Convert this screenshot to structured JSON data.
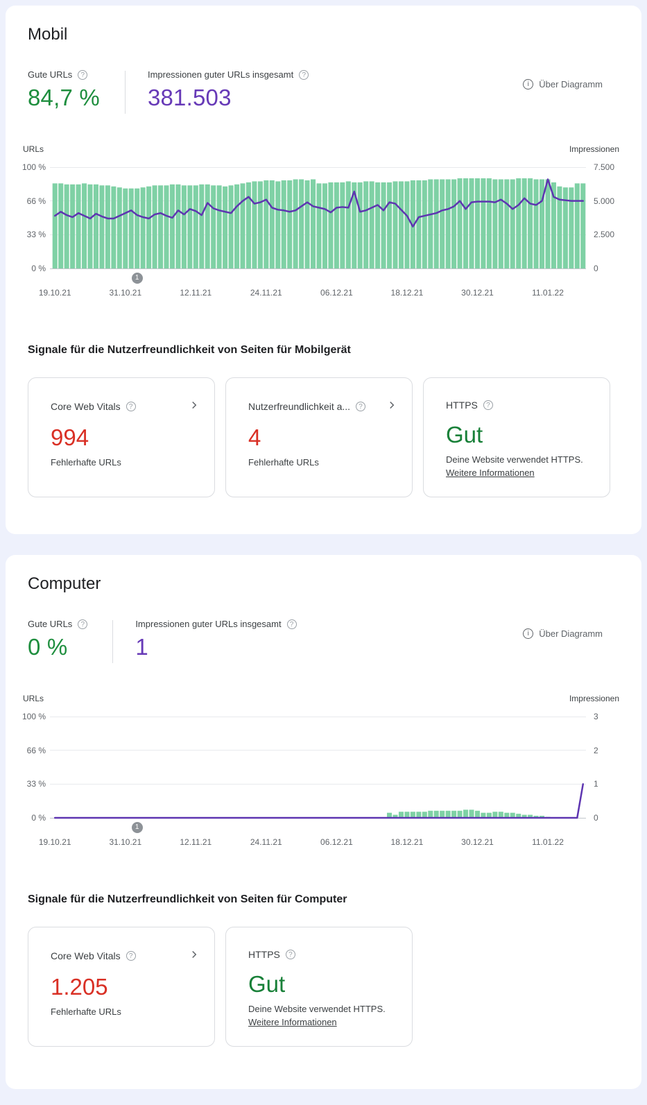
{
  "colors": {
    "stat_green": "#1e8e3e",
    "stat_purple": "#673ab7",
    "error_red": "#d93025",
    "good_green": "#188038",
    "bar_green": "#7fd1a5",
    "line_purple": "#5e35b1"
  },
  "sections": [
    {
      "title": "Mobil",
      "stats": {
        "good_urls_label": "Gute URLs",
        "good_urls_value": "84,7 %",
        "impressions_label": "Impressionen guter URLs insgesamt",
        "impressions_value": "381.503"
      },
      "about_chart": "Über Diagramm",
      "signals_title": "Signale für die Nutzerfreundlichkeit von Seiten für Mobilgerät",
      "cards": [
        {
          "title": "Core Web Vitals",
          "value": "994",
          "subtitle": "Fehlerhafte URLs"
        },
        {
          "title": "Nutzerfreundlichkeit a...",
          "value": "4",
          "subtitle": "Fehlerhafte URLs"
        },
        {
          "title": "HTTPS",
          "value": "Gut",
          "description": "Deine Website verwendet HTTPS.",
          "link_label": "Weitere Informationen"
        }
      ]
    },
    {
      "title": "Computer",
      "stats": {
        "good_urls_label": "Gute URLs",
        "good_urls_value": "0 %",
        "impressions_label": "Impressionen guter URLs insgesamt",
        "impressions_value": "1"
      },
      "about_chart": "Über Diagramm",
      "signals_title": "Signale für die Nutzerfreundlichkeit von Seiten für Computer",
      "cards": [
        {
          "title": "Core Web Vitals",
          "value": "1.205",
          "subtitle": "Fehlerhafte URLs"
        },
        {
          "title": "HTTPS",
          "value": "Gut",
          "description": "Deine Website verwendet HTTPS.",
          "link_label": "Weitere Informationen"
        }
      ]
    }
  ],
  "chart_data": [
    {
      "type": "bar",
      "title": "Mobil – Gute URLs (%) und Impressionen",
      "left_axis": {
        "title": "URLs",
        "ticks": [
          "100 %",
          "66 %",
          "33 %",
          "0 %"
        ],
        "max": 100
      },
      "right_axis": {
        "title": "Impressionen",
        "ticks": [
          "7.500",
          "5.000",
          "2.500",
          "0"
        ],
        "max": 7500
      },
      "x_ticks": [
        {
          "day": 0,
          "label": "19.10.21"
        },
        {
          "day": 12,
          "label": "31.10.21"
        },
        {
          "day": 24,
          "label": "12.11.21"
        },
        {
          "day": 36,
          "label": "24.11.21"
        },
        {
          "day": 48,
          "label": "06.12.21"
        },
        {
          "day": 60,
          "label": "18.12.21"
        },
        {
          "day": 72,
          "label": "30.12.21"
        },
        {
          "day": 84,
          "label": "11.01.22"
        }
      ],
      "marker": {
        "day": 14,
        "label": "1"
      },
      "bar_color": "#7fd1a5",
      "line_color": "#5e35b1",
      "bars_pct": [
        84,
        84,
        83,
        83,
        83,
        84,
        83,
        83,
        82,
        82,
        81,
        80,
        79,
        79,
        79,
        80,
        81,
        82,
        82,
        82,
        83,
        83,
        82,
        82,
        82,
        83,
        83,
        82,
        82,
        81,
        82,
        83,
        84,
        85,
        86,
        86,
        87,
        87,
        86,
        87,
        87,
        88,
        88,
        87,
        88,
        84,
        84,
        85,
        85,
        85,
        86,
        85,
        85,
        86,
        86,
        85,
        85,
        85,
        86,
        86,
        86,
        87,
        87,
        87,
        88,
        88,
        88,
        88,
        88,
        89,
        89,
        89,
        89,
        89,
        89,
        88,
        88,
        88,
        88,
        89,
        89,
        89,
        88,
        88,
        88,
        85,
        81,
        80,
        80,
        84,
        84
      ],
      "line_values": [
        3900,
        4200,
        3950,
        3800,
        4100,
        3900,
        3700,
        4050,
        3850,
        3700,
        3700,
        3900,
        4100,
        4300,
        3950,
        3800,
        3700,
        4000,
        4100,
        3900,
        3750,
        4300,
        4000,
        4400,
        4250,
        3950,
        4850,
        4450,
        4300,
        4200,
        4100,
        4600,
        5000,
        5300,
        4800,
        4900,
        5100,
        4500,
        4350,
        4300,
        4200,
        4300,
        4600,
        4900,
        4600,
        4500,
        4400,
        4150,
        4500,
        4550,
        4500,
        5700,
        4200,
        4300,
        4500,
        4700,
        4300,
        4900,
        4800,
        4350,
        3900,
        3100,
        3800,
        3900,
        4000,
        4100,
        4300,
        4400,
        4600,
        5000,
        4400,
        4900,
        4950,
        4950,
        4950,
        4900,
        5100,
        4800,
        4400,
        4700,
        5200,
        4800,
        4700,
        5000,
        6600,
        5300,
        5100,
        5050,
        5000,
        5000,
        5000
      ]
    },
    {
      "type": "bar",
      "title": "Computer – Gute URLs (%) und Impressionen",
      "left_axis": {
        "title": "URLs",
        "ticks": [
          "100 %",
          "66 %",
          "33 %",
          "0 %"
        ],
        "max": 100
      },
      "right_axis": {
        "title": "Impressionen",
        "ticks": [
          "3",
          "2",
          "1",
          "0"
        ],
        "max": 3
      },
      "x_ticks": [
        {
          "day": 0,
          "label": "19.10.21"
        },
        {
          "day": 12,
          "label": "31.10.21"
        },
        {
          "day": 24,
          "label": "12.11.21"
        },
        {
          "day": 36,
          "label": "24.11.21"
        },
        {
          "day": 48,
          "label": "06.12.21"
        },
        {
          "day": 60,
          "label": "18.12.21"
        },
        {
          "day": 72,
          "label": "30.12.21"
        },
        {
          "day": 84,
          "label": "11.01.22"
        }
      ],
      "marker": {
        "day": 14,
        "label": "1"
      },
      "bar_color": "#7fd1a5",
      "line_color": "#5e35b1",
      "bars_pct": [
        0,
        0,
        0,
        0,
        0,
        0,
        0,
        0,
        0,
        0,
        0,
        0,
        0,
        0,
        0,
        0,
        0,
        0,
        0,
        0,
        0,
        0,
        0,
        0,
        0,
        0,
        0,
        0,
        0,
        0,
        0,
        0,
        0,
        0,
        0,
        0,
        0,
        0,
        0,
        0,
        0,
        0,
        0,
        0,
        0,
        0,
        0,
        0,
        0,
        0,
        0,
        0,
        0,
        0,
        0,
        0,
        0,
        5,
        3,
        6,
        6,
        6,
        6,
        6,
        7,
        7,
        7,
        7,
        7,
        7,
        8,
        8,
        7,
        5,
        5,
        6,
        6,
        5,
        5,
        4,
        3,
        3,
        2,
        2,
        1,
        0,
        0,
        0,
        0,
        0,
        0
      ],
      "line_values": [
        0,
        0,
        0,
        0,
        0,
        0,
        0,
        0,
        0,
        0,
        0,
        0,
        0,
        0,
        0,
        0,
        0,
        0,
        0,
        0,
        0,
        0,
        0,
        0,
        0,
        0,
        0,
        0,
        0,
        0,
        0,
        0,
        0,
        0,
        0,
        0,
        0,
        0,
        0,
        0,
        0,
        0,
        0,
        0,
        0,
        0,
        0,
        0,
        0,
        0,
        0,
        0,
        0,
        0,
        0,
        0,
        0,
        0,
        0,
        0,
        0,
        0,
        0,
        0,
        0,
        0,
        0,
        0,
        0,
        0,
        0,
        0,
        0,
        0,
        0,
        0,
        0,
        0,
        0,
        0,
        0,
        0,
        0,
        0,
        0,
        0,
        0,
        0,
        0,
        0,
        1
      ]
    }
  ]
}
